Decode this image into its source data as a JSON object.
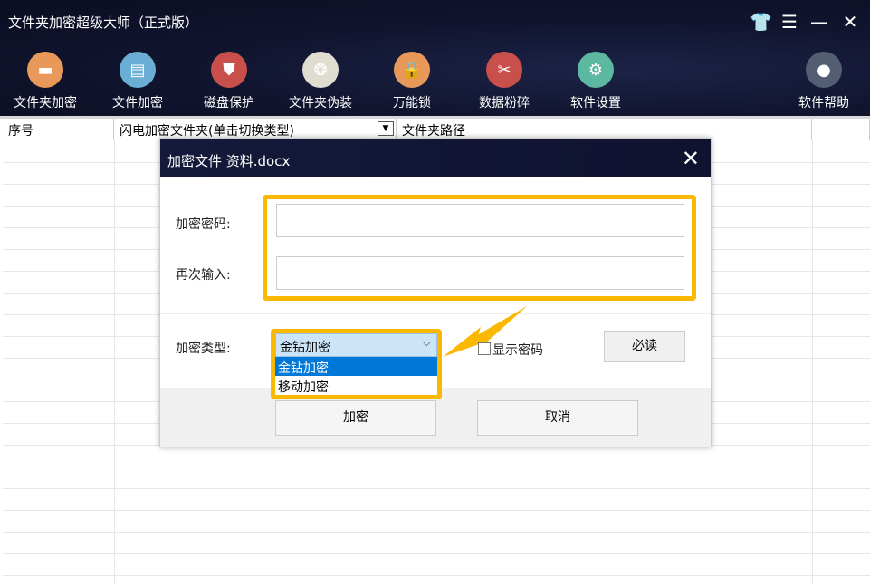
{
  "app": {
    "title": "文件夹加密超级大师（正式版）"
  },
  "window_controls": [
    {
      "icon": "shirt-icon",
      "glyph": "👕"
    },
    {
      "icon": "menu-icon",
      "glyph": "☰"
    },
    {
      "icon": "minimize-icon",
      "glyph": "—"
    },
    {
      "icon": "close-icon",
      "glyph": "✕"
    }
  ],
  "toolbar": [
    {
      "label": "文件夹加密",
      "icon": "folder-icon",
      "color": "#e8995a",
      "glyph": "▬"
    },
    {
      "label": "文件加密",
      "icon": "clipboard-icon",
      "color": "#6aaed6",
      "glyph": "▤"
    },
    {
      "label": "磁盘保护",
      "icon": "shield-icon",
      "color": "#c9504a",
      "glyph": "⛊"
    },
    {
      "label": "文件夹伪装",
      "icon": "palette-icon",
      "color": "#e0ddd0",
      "glyph": "❂"
    },
    {
      "label": "万能锁",
      "icon": "lock-icon",
      "color": "#e8995a",
      "glyph": "🔒"
    },
    {
      "label": "数据粉碎",
      "icon": "scissors-icon",
      "color": "#c9504a",
      "glyph": "✂"
    },
    {
      "label": "软件设置",
      "icon": "gear-icon",
      "color": "#5cb8a0",
      "glyph": "⚙"
    },
    {
      "label": "软件帮助",
      "icon": "user-icon",
      "color": "#535e72",
      "glyph": "●"
    }
  ],
  "table": {
    "columns": [
      "序号",
      "闪电加密文件夹(单击切换类型)",
      "文件夹路径"
    ]
  },
  "dialog": {
    "title": "加密文件  资料.docx",
    "password_label": "加密密码:",
    "password_value": "",
    "confirm_label": "再次输入:",
    "confirm_value": "",
    "type_label": "加密类型:",
    "type_selected": "金钻加密",
    "type_options": [
      "金钻加密",
      "移动加密"
    ],
    "show_password_label": "显示密码",
    "show_password_checked": false,
    "must_read_label": "必读",
    "encrypt_label": "加密",
    "cancel_label": "取消",
    "highlight_color": "#fbb800"
  }
}
